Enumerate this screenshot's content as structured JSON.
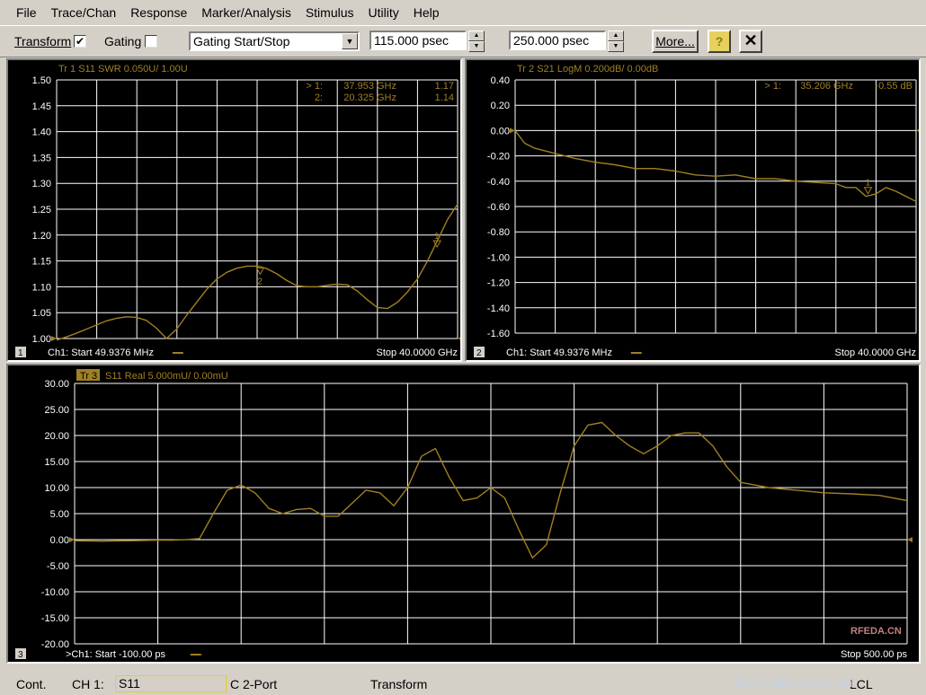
{
  "menu": [
    "File",
    "Trace/Chan",
    "Response",
    "Marker/Analysis",
    "Stimulus",
    "Utility",
    "Help"
  ],
  "toolbar": {
    "transform_label": "Transform",
    "transform_checked": true,
    "gating_label": "Gating",
    "gating_checked": false,
    "select_value": "Gating Start/Stop",
    "start_value": "115.000 psec",
    "stop_value": "250.000 psec",
    "more_label": "More...",
    "help_icon": "question-icon",
    "close_icon": "close-icon"
  },
  "colors": {
    "trace": "#a08020",
    "grid": "#ffffff",
    "background": "#ffffff",
    "text": "#a08020"
  },
  "windows": [
    {
      "number": "1",
      "header": "Tr  1   S11 SWR 0.050U/  1.00U",
      "ticks": [
        "1.50",
        "1.45",
        "1.40",
        "1.35",
        "1.30",
        "1.25",
        "1.20",
        "1.15",
        "1.10",
        "1.05",
        "1.00"
      ],
      "markers": [
        {
          "ref": "> 1:",
          "x": "37.953 GHz",
          "y": "1.17"
        },
        {
          "ref": "2:",
          "x": "20.325 GHz",
          "y": "1.14"
        }
      ],
      "footer_start": "Ch1: Start  49.9376 MHz",
      "footer_stop": "Stop  40.0000 GHz"
    },
    {
      "number": "2",
      "header": "Tr  2   S21 LogM 0.200dB/  0.00dB",
      "ticks": [
        "0.40",
        "0.20",
        "0.00",
        "-0.20",
        "-0.40",
        "-0.60",
        "-0.80",
        "-1.00",
        "-1.20",
        "-1.40",
        "-1.60"
      ],
      "markers": [
        {
          "ref": "> 1:",
          "x": "35.206 GHz",
          "y": "-0.55 dB"
        }
      ],
      "footer_start": "Ch1: Start  49.9376 MHz",
      "footer_stop": "Stop  40.0000 GHz"
    },
    {
      "number": "3",
      "header_tr": "Tr  3",
      "header": "S11 Real 5.000mU/  0.00mU",
      "ticks": [
        "30.00",
        "25.00",
        "20.00",
        "15.00",
        "10.00",
        "5.00",
        "0.00",
        "-5.00",
        "-10.00",
        "-15.00",
        "-20.00"
      ],
      "footer_start": ">Ch1: Start  -100.00 ps",
      "footer_stop": "Stop  500.00 ps"
    }
  ],
  "chart_data": [
    {
      "type": "line",
      "title": "Tr  1   S11 SWR 0.050U/  1.00U",
      "xlim": [
        0.0499376,
        40
      ],
      "ylim": [
        1.0,
        1.5
      ],
      "series": [
        {
          "name": "S11 SWR",
          "x": [
            0.05,
            1,
            2,
            3,
            4,
            5,
            6,
            7,
            8,
            9,
            10,
            11,
            12,
            13,
            14,
            15,
            16,
            17,
            18,
            19,
            20,
            20.3,
            21,
            22,
            23,
            24,
            25,
            26,
            27,
            28,
            29,
            30,
            31,
            32,
            33,
            34,
            35,
            36,
            37,
            38,
            39,
            40
          ],
          "y": [
            0.997,
            1.003,
            1.01,
            1.018,
            1.026,
            1.034,
            1.039,
            1.042,
            1.041,
            1.035,
            1.02,
            1.0,
            1.018,
            1.045,
            1.07,
            1.095,
            1.115,
            1.128,
            1.136,
            1.14,
            1.14,
            1.139,
            1.135,
            1.125,
            1.112,
            1.102,
            1.1,
            1.1,
            1.103,
            1.105,
            1.104,
            1.092,
            1.075,
            1.06,
            1.058,
            1.07,
            1.09,
            1.115,
            1.15,
            1.19,
            1.23,
            1.26
          ]
        }
      ]
    },
    {
      "type": "line",
      "title": "Tr  2   S21 LogM 0.200dB/  0.00dB",
      "xlim": [
        0.0499376,
        40
      ],
      "ylim": [
        -1.6,
        0.4
      ],
      "series": [
        {
          "name": "S21 LogM",
          "x": [
            0.05,
            1,
            2,
            4,
            6,
            8,
            10,
            12,
            14,
            16,
            18,
            20,
            22,
            24,
            26,
            28,
            30,
            32,
            33,
            34,
            35,
            36,
            37,
            38,
            39,
            40
          ],
          "y": [
            0.0,
            -0.1,
            -0.14,
            -0.18,
            -0.22,
            -0.25,
            -0.27,
            -0.3,
            -0.3,
            -0.32,
            -0.35,
            -0.36,
            -0.35,
            -0.38,
            -0.38,
            -0.4,
            -0.41,
            -0.42,
            -0.45,
            -0.45,
            -0.52,
            -0.5,
            -0.45,
            -0.48,
            -0.52,
            -0.56
          ]
        }
      ]
    },
    {
      "type": "line",
      "title": "S11 Real 5.000mU/  0.00mU",
      "xlim": [
        -100,
        500
      ],
      "ylim": [
        -20,
        30
      ],
      "series": [
        {
          "name": "S11 Real",
          "x": [
            -100,
            -80,
            -60,
            -40,
            -30,
            -20,
            -10,
            0,
            10,
            20,
            30,
            40,
            50,
            60,
            70,
            80,
            90,
            100,
            110,
            120,
            130,
            140,
            150,
            160,
            170,
            180,
            190,
            200,
            210,
            220,
            230,
            240,
            250,
            260,
            270,
            280,
            290,
            300,
            310,
            320,
            330,
            340,
            350,
            360,
            370,
            380,
            390,
            400,
            420,
            440,
            460,
            480,
            500
          ],
          "y": [
            -0.2,
            -0.3,
            -0.2,
            -0.1,
            -0.1,
            0.0,
            0.2,
            5,
            9.5,
            10.5,
            9,
            6,
            5,
            5.8,
            6,
            4.5,
            4.5,
            7,
            9.5,
            9,
            6.5,
            10,
            16,
            17.5,
            12,
            7.5,
            8,
            10,
            8,
            2,
            -3.5,
            -1,
            9,
            18,
            22,
            22.5,
            20,
            18,
            16.5,
            18,
            20,
            20.5,
            20.5,
            18,
            14,
            11,
            10.5,
            10,
            9.5,
            9,
            8.8,
            8.5,
            7.5
          ]
        }
      ]
    }
  ],
  "status": {
    "mode": "Cont.",
    "channel": "CH 1:",
    "param": "S11",
    "cal": "C  2-Port",
    "transform": "Transform",
    "lcl": "LCL"
  },
  "watermark": {
    "top": "RFEDA.CN",
    "url": "http://bbs.rfeda.cn"
  }
}
